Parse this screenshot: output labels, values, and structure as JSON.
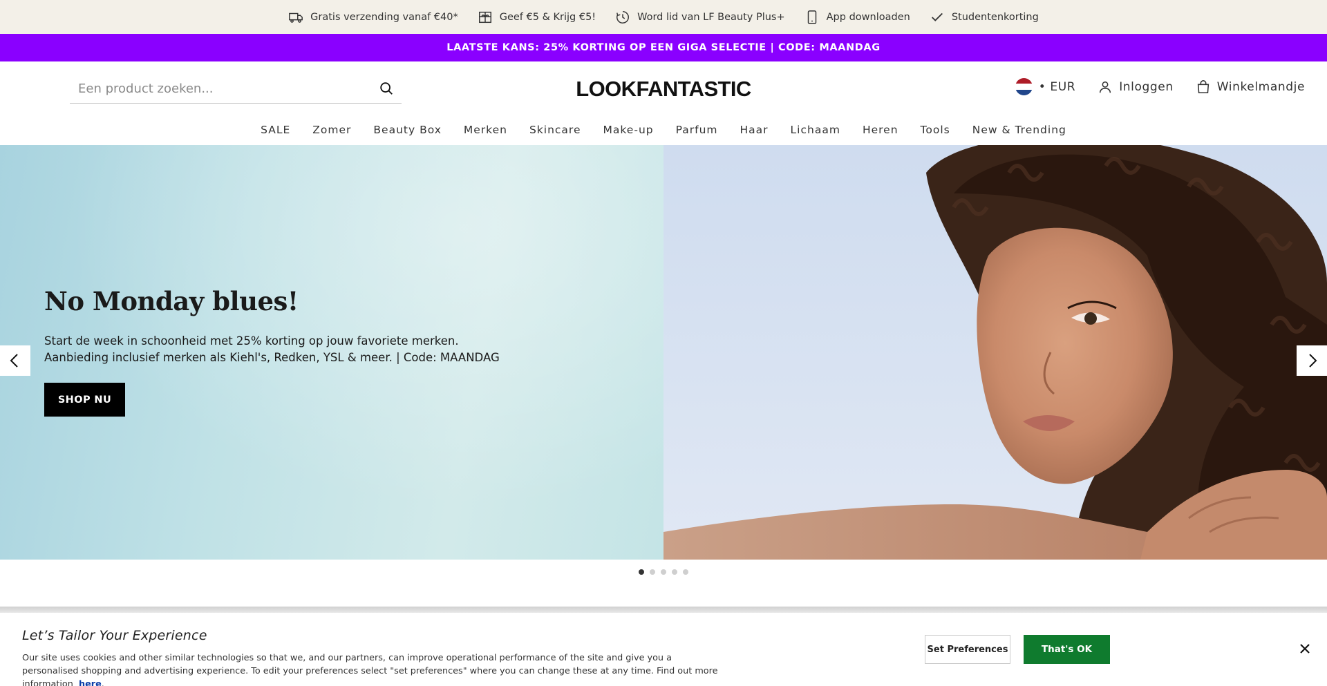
{
  "utility_bar": {
    "items": [
      {
        "icon": "truck-icon",
        "label": "Gratis verzending vanaf €40*"
      },
      {
        "icon": "gift-icon",
        "label": "Geef €5 & Krijg €5!"
      },
      {
        "icon": "loyalty-icon",
        "label": "Word lid van LF Beauty Plus+"
      },
      {
        "icon": "phone-icon",
        "label": "App downloaden"
      },
      {
        "icon": "check-icon",
        "label": "Studentenkorting"
      }
    ]
  },
  "promo": {
    "text": "LAATSTE KANS: 25% KORTING OP EEN GIGA SELECTIE | CODE: MAANDAG",
    "color": "#8a00ff"
  },
  "header": {
    "search_placeholder": "Een product zoeken...",
    "logo": "LOOKFANTASTIC",
    "currency": "• EUR",
    "login": "Inloggen",
    "cart": "Winkelmandje"
  },
  "nav": {
    "items": [
      "SALE",
      "Zomer",
      "Beauty Box",
      "Merken",
      "Skincare",
      "Make-up",
      "Parfum",
      "Haar",
      "Lichaam",
      "Heren",
      "Tools",
      "New & Trending"
    ]
  },
  "hero": {
    "title": "No Monday blues!",
    "text": "Start de week in schoonheid met 25% korting op jouw favoriete merken. Aanbieding inclusief merken als Kiehl's, Redken, YSL & meer. | Code: MAANDAG",
    "cta": "SHOP NU",
    "slide_count": 5,
    "active_slide": 1
  },
  "cookie": {
    "title": "Let’s Tailor Your Experience",
    "text": "Our site uses cookies and other similar technologies so that we, and our partners, can improve operational performance of the site and give you a personalised shopping and advertising experience. To edit your preferences select \"set preferences\" where you can change these at any time. Find out more information",
    "link": "here",
    "preferences_button": "Set Preferences",
    "ok_button": "That's OK",
    "ok_color": "#0f7b2e"
  }
}
